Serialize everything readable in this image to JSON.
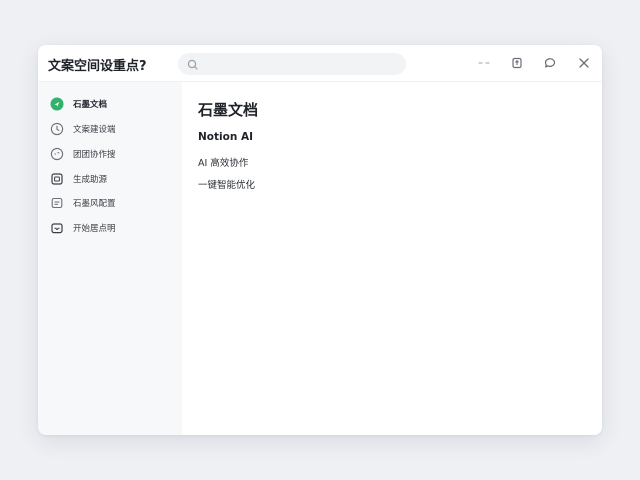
{
  "window": {
    "title": "文案空间设重点?",
    "search": {
      "placeholder": ""
    }
  },
  "sidebar": {
    "items": [
      {
        "label": "石墨文档",
        "icon": "check-circle-icon",
        "active": true
      },
      {
        "label": "文案建设端",
        "icon": "clock-icon",
        "active": false
      },
      {
        "label": "团团协作搜",
        "icon": "chat-bubble-icon",
        "active": false
      },
      {
        "label": "生成助源",
        "icon": "image-frame-icon",
        "active": false
      },
      {
        "label": "石墨风配置",
        "icon": "card-icon",
        "active": false
      },
      {
        "label": "开始居点明",
        "icon": "inbox-icon",
        "active": false
      }
    ]
  },
  "main": {
    "title": "石墨文档",
    "subtitle": "Notion AI",
    "lines": [
      "AI 高效协作",
      "一键智能优化"
    ]
  },
  "colors": {
    "accent": "#2fb36a",
    "window_bg": "#ffffff",
    "sidebar_bg": "#f7f8fa",
    "page_bg": "#eef0f4"
  }
}
